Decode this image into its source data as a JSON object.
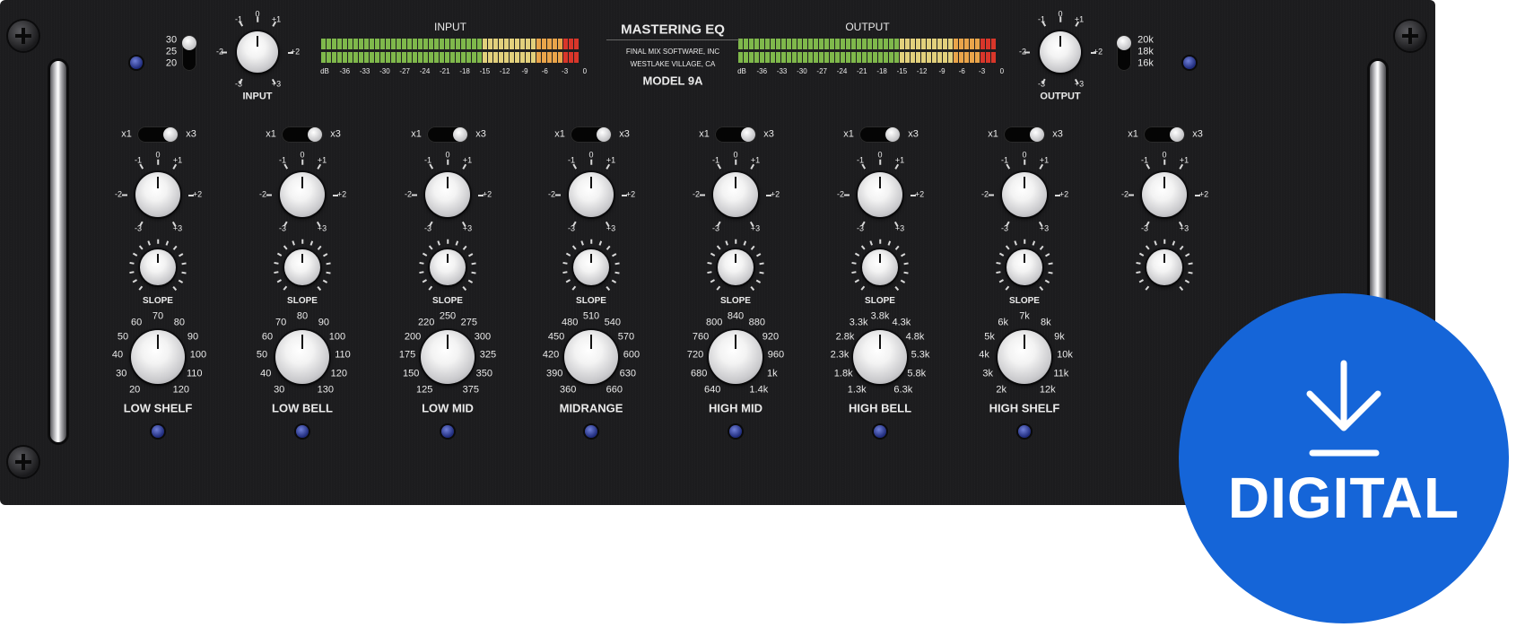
{
  "plugin": {
    "title": "MASTERING EQ",
    "maker_line1": "FINAL MIX SOFTWARE, INC",
    "maker_line2": "WESTLAKE VILLAGE, CA",
    "model": "MODEL 9A"
  },
  "meters": {
    "input_label": "INPUT",
    "output_label": "OUTPUT",
    "scale": [
      "dB",
      "-36",
      "-33",
      "-30",
      "-27",
      "-24",
      "-21",
      "-18",
      "-15",
      "-12",
      "-9",
      "-6",
      "-3",
      "0"
    ]
  },
  "gain_knob": {
    "scale": [
      "-3",
      "-2",
      "-1",
      "0",
      "+1",
      "+2",
      "+3"
    ]
  },
  "input_control": {
    "label": "INPUT",
    "hp_options": [
      "30",
      "25",
      "20"
    ]
  },
  "output_control": {
    "label": "OUTPUT",
    "lp_options": [
      "20k",
      "18k",
      "16k"
    ]
  },
  "multiplier": {
    "low": "x1",
    "high": "x3"
  },
  "slope_label": "SLOPE",
  "bands": [
    {
      "name": "LOW SHELF",
      "freqs": [
        "20",
        "30",
        "40",
        "50",
        "60",
        "70",
        "80",
        "90",
        "100",
        "110",
        "120"
      ]
    },
    {
      "name": "LOW BELL",
      "freqs": [
        "30",
        "40",
        "50",
        "60",
        "70",
        "80",
        "90",
        "100",
        "110",
        "120",
        "130"
      ]
    },
    {
      "name": "LOW MID",
      "freqs": [
        "125",
        "150",
        "175",
        "200",
        "220",
        "250",
        "275",
        "300",
        "325",
        "350",
        "375"
      ]
    },
    {
      "name": "MIDRANGE",
      "freqs": [
        "360",
        "390",
        "420",
        "450",
        "480",
        "510",
        "540",
        "570",
        "600",
        "630",
        "660"
      ]
    },
    {
      "name": "HIGH MID",
      "freqs": [
        "640",
        "680",
        "720",
        "760",
        "800",
        "840",
        "880",
        "920",
        "960",
        "1k",
        "1.4k"
      ]
    },
    {
      "name": "HIGH BELL",
      "freqs": [
        "1.3k",
        "1.8k",
        "2.3k",
        "2.8k",
        "3.3k",
        "3.8k",
        "4.3k",
        "4.8k",
        "5.3k",
        "5.8k",
        "6.3k"
      ]
    },
    {
      "name": "HIGH SHELF",
      "freqs": [
        "2k",
        "3k",
        "4k",
        "5k",
        "6k",
        "7k",
        "8k",
        "9k",
        "10k",
        "11k",
        "12k"
      ]
    },
    {
      "name": "",
      "freqs": []
    }
  ],
  "badge": {
    "text": "DIGITAL",
    "icon": "download-icon",
    "color": "#1565d8"
  },
  "colors": {
    "panel": "#1c1c1e",
    "led": "#3b4bb8",
    "text": "#eaeaea"
  }
}
